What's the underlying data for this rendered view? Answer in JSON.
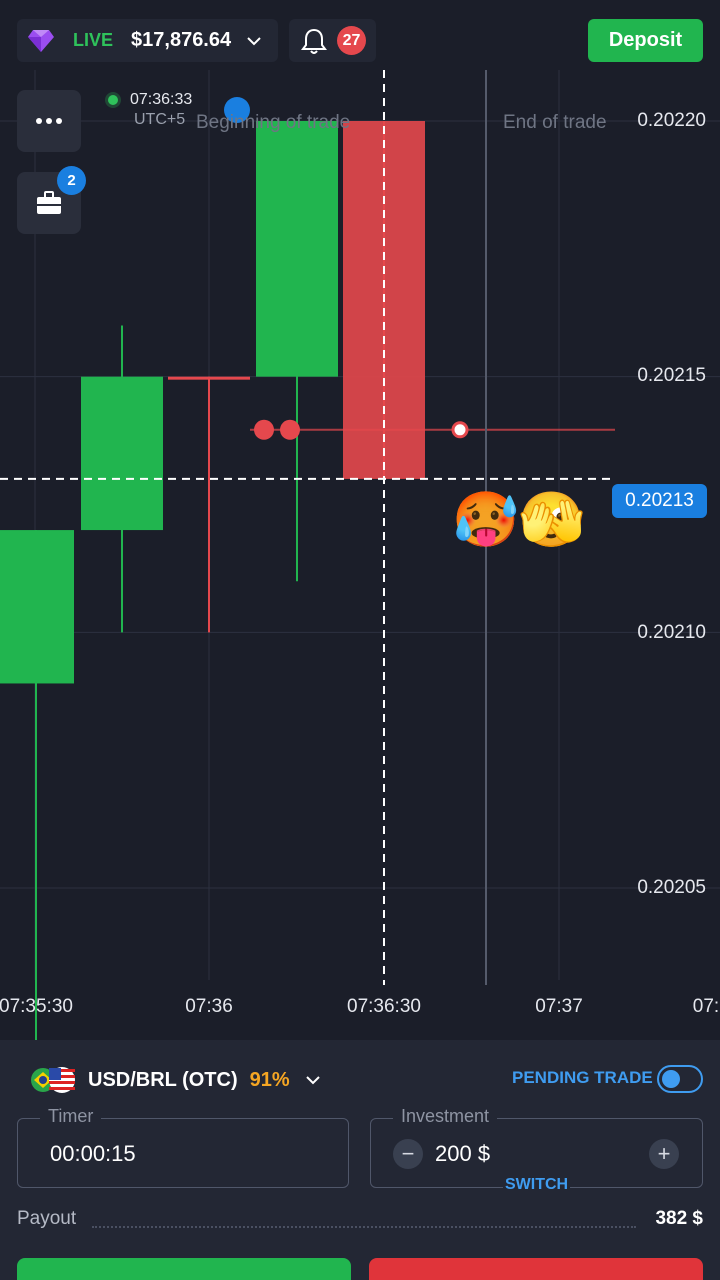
{
  "header": {
    "account_type": "LIVE",
    "balance": "$17,876.64",
    "notifications_count": "27",
    "deposit_label": "Deposit"
  },
  "chart": {
    "price_labels": [
      "0.20220",
      "0.20215",
      "0.20210",
      "0.20205"
    ],
    "current_price": "0.20213",
    "time_labels": [
      "07:35:30",
      "07:36",
      "07:36:30",
      "07:37",
      "07:"
    ],
    "clock_time": "07:36:33",
    "clock_tz": "UTC+5",
    "beginning_label": "Beginning of trade",
    "end_label": "End of trade",
    "open_trades_count": "2",
    "emojis": [
      "🥵",
      "🫣"
    ]
  },
  "chart_data": {
    "type": "candlestick",
    "y_unit": "price",
    "ylim": [
      0.20202,
      0.20222
    ],
    "candles": [
      {
        "open": 0.20209,
        "close": 0.20212,
        "high": 0.20212,
        "low": 0.20202,
        "color": "green"
      },
      {
        "open": 0.20212,
        "close": 0.20215,
        "high": 0.20216,
        "low": 0.2021,
        "color": "green"
      },
      {
        "open": 0.20215,
        "close": 0.20215,
        "high": 0.20215,
        "low": 0.2021,
        "color": "red"
      },
      {
        "open": 0.20215,
        "close": 0.2022,
        "high": 0.2022,
        "low": 0.20211,
        "color": "green"
      },
      {
        "open": 0.2022,
        "close": 0.20213,
        "high": 0.2022,
        "low": 0.20213,
        "color": "red"
      }
    ],
    "trade_entry_price": 0.20214,
    "current_price": 0.20213
  },
  "trade": {
    "pair": "USD/BRL (OTC)",
    "payout_pct": "91%",
    "pending_label": "PENDING TRADE",
    "timer_label": "Timer",
    "timer_value": "00:00:15",
    "investment_label": "Investment",
    "investment_value": "200 $",
    "switch_label": "SWITCH",
    "payout_label": "Payout",
    "payout_value": "382 $"
  },
  "colors": {
    "bg": "#1b1e29",
    "green": "#21b54f",
    "red": "#e0343a",
    "accent": "#1a7fe0"
  }
}
